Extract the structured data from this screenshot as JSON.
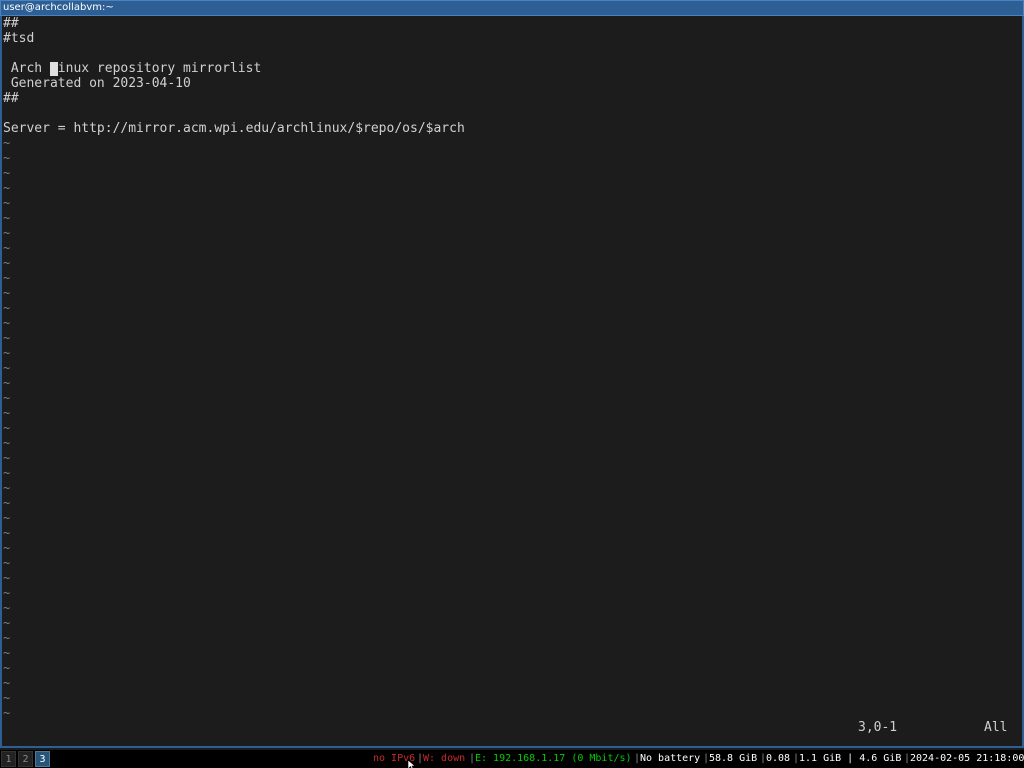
{
  "window": {
    "title": "user@archcollabvm:~"
  },
  "editor": {
    "lines": [
      "##",
      "#tsd",
      "",
      " Arch Linux repository mirrorlist",
      " Generated on 2023-04-10",
      "##",
      "",
      "Server = http://mirror.acm.wpi.edu/archlinux/$repo/os/$arch"
    ],
    "tilde": "~",
    "tilde_count": 39,
    "cursor_line": 3,
    "ruler_position": "3,0-1",
    "ruler_scroll": "All"
  },
  "bar": {
    "workspaces": [
      "1",
      "2",
      "3"
    ],
    "active_workspace": "3",
    "ipv6": "no IPv6",
    "wireless": "W: down",
    "ethernet": "E: 192.168.1.17 (0 Mbit/s)",
    "battery": "No battery",
    "disk": "58.8 GiB",
    "load": "0.08",
    "memory": "1.1 GiB | 4.6 GiB",
    "datetime": "2024-02-05 21:18:00",
    "colors": {
      "bad": "#cc2a2a",
      "good": "#00cc00",
      "active_workspace": "#285577"
    }
  }
}
